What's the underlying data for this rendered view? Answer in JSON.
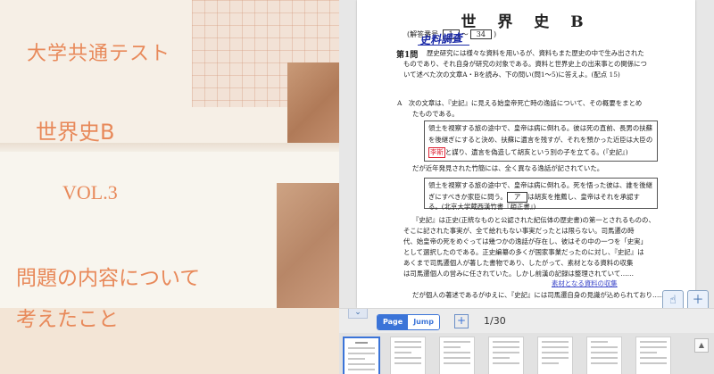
{
  "cover": {
    "line1": "大学共通テスト",
    "line2": "世界史B",
    "line3": "VOL.3",
    "line4": "問題の内容について",
    "line5": "考えたこと"
  },
  "page": {
    "title": "世 界 史 B",
    "answer_label": "(解答番号",
    "answer_from": "1",
    "answer_sep": "～",
    "answer_to": "34",
    "answer_close": ")",
    "handwriting": "史料調査",
    "question_heading": "第1問",
    "question_lines": [
      "歴史研究には様々な資料を用いるが、資料もまた歴史の中で生み出された",
      "ものであり、それ自身が研究の対象である。資料と世界史上の出来事との関係につ",
      "いて述べた次の文章A・Bを読み、下の問い(問1～5)に答えよ。(配点 15)"
    ],
    "sectionA": [
      "A　次の文章は、『史記』に見える始皇帝死亡時の逸話について、その概要をまとめ",
      "たものである。"
    ],
    "box1": [
      "領土を視察する旅の途中で、皇帝は病に倒れる。彼は死の直前、長男の扶蘇",
      "を後継ぎにすると決め、扶蘇に遺言を残すが、それを預かった近臣は大臣の",
      "と謀り、遺言を偽造して胡亥という別の子を立てる。(『史記』)"
    ],
    "box1_red": "李斯",
    "mid_line": "だが近年発見された竹簡には、全く異なる逸話が記されていた。",
    "box2": [
      "領土を視察する旅の途中で、皇帝は病に倒れる。死を悟った彼は、誰を後継",
      "ぎにすべきか家臣に問う。",
      "は胡亥を推薦し、皇帝はそれを承認す",
      "る。(北京大学蔵西漢竹書『趙正書』)"
    ],
    "box2_ablank": "ア",
    "body_lines": [
      "『史記』は正史(正統なものと公認された紀伝体の歴史書)の第一とされるものの、",
      "そこに記された事実が、全て絵れもない事実だったとは限らない。司馬遷の時",
      "代、始皇帝の死をめぐっては幾つかの逸話が存在し、彼はその中の一つを「史実」",
      "として選択したのである。正史編纂の多くが国家事業だったのに対し、『史記』は",
      "あくまで司馬遷個人が著した書物であり、したがって、素材となる資料の収集",
      "は司馬遷個人の営みに任されていた。しかし前漢の記録は整理されていて……",
      "だが個人の著述であるがゆえに、『史記』には司馬遷自身の見識が込められており……"
    ],
    "highlight": "素材となる資料の収集"
  },
  "toolbar": {
    "collapse_icon": "chevron-down",
    "page_label": "Page",
    "jump_label": "Jump",
    "add_label": "+",
    "page_indicator": "1/30"
  },
  "colors": {
    "cover_text": "#e8895a",
    "accent": "#3b74d8",
    "handwriting": "#1b2aa8",
    "red_mark": "#dd2233"
  }
}
